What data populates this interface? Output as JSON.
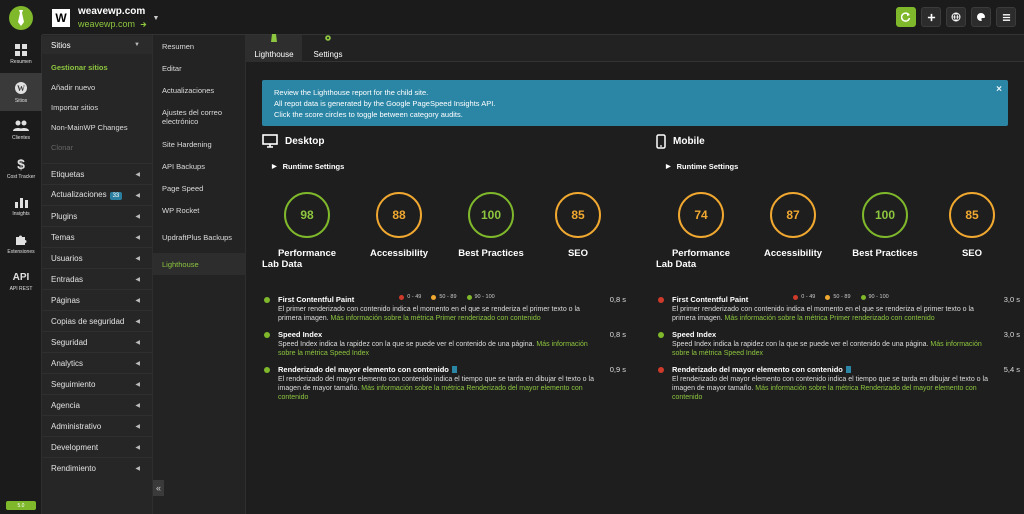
{
  "app": {
    "site_name": "weavewp.com",
    "site_url": "weavewp.com",
    "site_logo_letter": "W",
    "accent_color": "#7fb82b",
    "link_color": "#8dc63f",
    "notice_color": "#2b86a6"
  },
  "top_actions": [
    {
      "name": "sync-icon"
    },
    {
      "name": "plus-icon"
    },
    {
      "name": "globe-icon"
    },
    {
      "name": "palette-icon"
    },
    {
      "name": "menu-icon"
    }
  ],
  "rail": {
    "items": [
      {
        "label": "Resumen",
        "icon": "grid-icon"
      },
      {
        "label": "Sitios",
        "icon": "wordpress-icon"
      },
      {
        "label": "Clientes",
        "icon": "users-icon"
      },
      {
        "label": "Cost Tracker",
        "icon": "dollar-icon"
      },
      {
        "label": "Insights",
        "icon": "chart-icon"
      },
      {
        "label": "Extensiones",
        "icon": "puzzle-icon"
      },
      {
        "label": "API REST",
        "icon": "api-icon",
        "text": "API"
      }
    ],
    "version": "5.0"
  },
  "menu": {
    "header": "Sitios",
    "sub_items": [
      {
        "label": "Gestionar sitios",
        "state": "active"
      },
      {
        "label": "Añadir nuevo",
        "state": ""
      },
      {
        "label": "Importar sitios",
        "state": ""
      },
      {
        "label": "Non-MainWP Changes",
        "state": ""
      },
      {
        "label": "Clonar",
        "state": "disabled"
      }
    ],
    "rows": [
      {
        "label": "Etiquetas",
        "badge": ""
      },
      {
        "label": "Actualizaciones",
        "badge": "33"
      },
      {
        "label": "Plugins",
        "badge": ""
      },
      {
        "label": "Temas",
        "badge": ""
      },
      {
        "label": "Usuarios",
        "badge": ""
      },
      {
        "label": "Entradas",
        "badge": ""
      },
      {
        "label": "Páginas",
        "badge": ""
      },
      {
        "label": "Copias de seguridad",
        "badge": ""
      },
      {
        "label": "Seguridad",
        "badge": ""
      },
      {
        "label": "Analytics",
        "badge": ""
      },
      {
        "label": "Seguimiento",
        "badge": ""
      },
      {
        "label": "Agencia",
        "badge": ""
      },
      {
        "label": "Administrativo",
        "badge": ""
      },
      {
        "label": "Development",
        "badge": ""
      },
      {
        "label": "Rendimiento",
        "badge": ""
      }
    ]
  },
  "site_menu": {
    "items": [
      {
        "label": "Resumen",
        "active": false
      },
      {
        "label": "Editar",
        "active": false
      },
      {
        "label": "Actualizaciones",
        "active": false
      },
      {
        "label": "Ajustes del correo electrónico",
        "active": false
      },
      {
        "label": "Site Hardening",
        "active": false
      },
      {
        "label": "API Backups",
        "active": false
      },
      {
        "label": "Page Speed",
        "active": false
      },
      {
        "label": "WP Rocket",
        "active": false
      },
      {
        "label": "UpdraftPlus Backups",
        "active": false
      },
      {
        "label": "Lighthouse",
        "active": true
      }
    ],
    "collapse_glyph": "«"
  },
  "tabs": [
    {
      "label": "Lighthouse",
      "active": true
    },
    {
      "label": "Settings",
      "active": false
    }
  ],
  "notice": {
    "lines": [
      "Review the Lighthouse report for the child site.",
      "All repot data is generated by the Google PageSpeed Insights API.",
      "Click the score circles to toggle between category audits."
    ],
    "close": "×"
  },
  "desktop": {
    "title": "Desktop",
    "runtime": "Runtime Settings",
    "scores": [
      {
        "label": "Performance",
        "value": "98",
        "level": "good"
      },
      {
        "label": "Accessibility",
        "value": "88",
        "level": "avg"
      },
      {
        "label": "Best Practices",
        "value": "100",
        "level": "good"
      },
      {
        "label": "SEO",
        "value": "85",
        "level": "avg"
      }
    ]
  },
  "mobile": {
    "title": "Mobile",
    "runtime": "Runtime Settings",
    "scores": [
      {
        "label": "Performance",
        "value": "74",
        "level": "avg"
      },
      {
        "label": "Accessibility",
        "value": "87",
        "level": "avg"
      },
      {
        "label": "Best Practices",
        "value": "100",
        "level": "good"
      },
      {
        "label": "SEO",
        "value": "85",
        "level": "avg"
      }
    ]
  },
  "legend": [
    {
      "label": "0 - 49",
      "color": "#d03a2a"
    },
    {
      "label": "50 - 89",
      "color": "#f0a830"
    },
    {
      "label": "90 - 100",
      "color": "#7fb82b"
    }
  ],
  "lab_desktop": {
    "title": "Lab Data",
    "metrics": [
      {
        "name": "First Contentful Paint",
        "desc": "El primer renderizado con contenido indica el momento en el que se renderiza el primer texto o la primera imagen.",
        "link": "Más información sobre la métrica Primer renderizado con contenido",
        "value": "0,8 s",
        "level": "good",
        "bookmark": false
      },
      {
        "name": "Speed Index",
        "desc": "Speed Index indica la rapidez con la que se puede ver el contenido de una página.",
        "link": "Más información sobre la métrica Speed Index",
        "value": "0,8 s",
        "level": "good",
        "bookmark": false
      },
      {
        "name": "Renderizado del mayor elemento con contenido",
        "desc": "El renderizado del mayor elemento con contenido indica el tiempo que se tarda en dibujar el texto o la imagen de mayor tamaño.",
        "link": "Más información sobre la métrica Renderizado del mayor elemento con contenido",
        "value": "0,9 s",
        "level": "good",
        "bookmark": true
      }
    ]
  },
  "lab_mobile": {
    "title": "Lab Data",
    "metrics": [
      {
        "name": "First Contentful Paint",
        "desc": "El primer renderizado con contenido indica el momento en el que se renderiza el primer texto o la primera imagen.",
        "link": "Más información sobre la métrica Primer renderizado con contenido",
        "value": "3,0 s",
        "level": "bad",
        "bookmark": false
      },
      {
        "name": "Speed Index",
        "desc": "Speed Index indica la rapidez con la que se puede ver el contenido de una página.",
        "link": "Más información sobre la métrica Speed Index",
        "value": "3,0 s",
        "level": "good",
        "bookmark": false
      },
      {
        "name": "Renderizado del mayor elemento con contenido",
        "desc": "El renderizado del mayor elemento con contenido indica el tiempo que se tarda en dibujar el texto o la imagen de mayor tamaño.",
        "link": "Más información sobre la métrica Renderizado del mayor elemento con contenido",
        "value": "5,4 s",
        "level": "bad",
        "bookmark": true
      }
    ]
  }
}
